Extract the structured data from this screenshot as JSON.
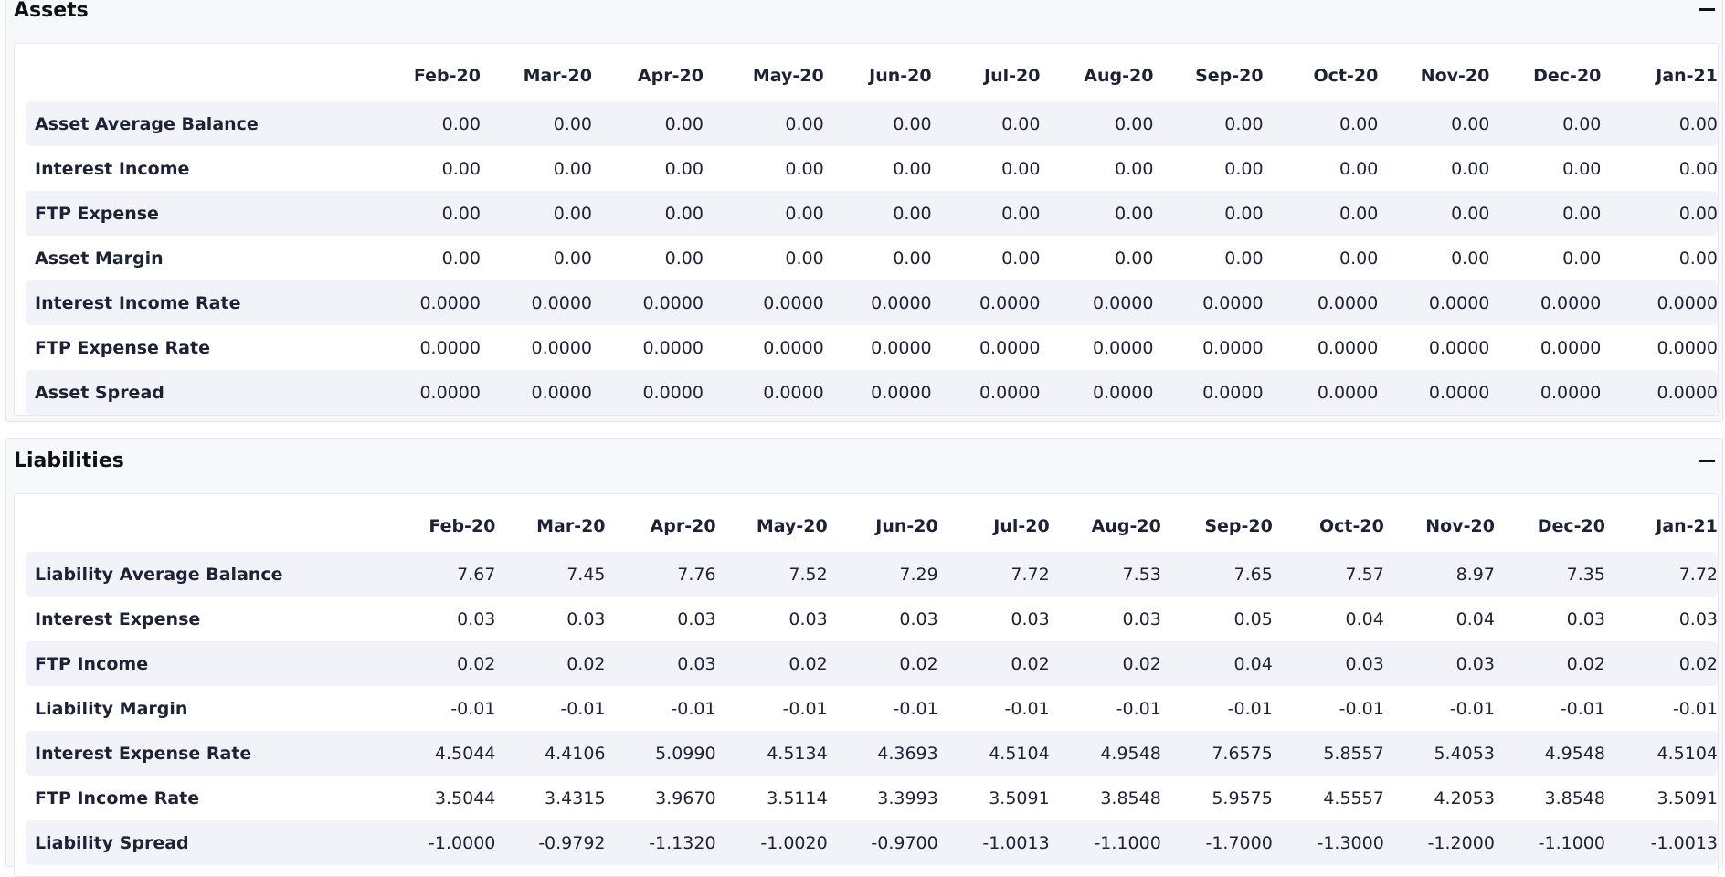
{
  "months": [
    "Feb-20",
    "Mar-20",
    "Apr-20",
    "May-20",
    "Jun-20",
    "Jul-20",
    "Aug-20",
    "Sep-20",
    "Oct-20",
    "Nov-20",
    "Dec-20",
    "Jan-21"
  ],
  "assets": {
    "title": "Assets",
    "rows": [
      {
        "label": "Asset Average Balance",
        "values": [
          "0.00",
          "0.00",
          "0.00",
          "0.00",
          "0.00",
          "0.00",
          "0.00",
          "0.00",
          "0.00",
          "0.00",
          "0.00",
          "0.00"
        ]
      },
      {
        "label": "Interest Income",
        "values": [
          "0.00",
          "0.00",
          "0.00",
          "0.00",
          "0.00",
          "0.00",
          "0.00",
          "0.00",
          "0.00",
          "0.00",
          "0.00",
          "0.00"
        ]
      },
      {
        "label": "FTP Expense",
        "values": [
          "0.00",
          "0.00",
          "0.00",
          "0.00",
          "0.00",
          "0.00",
          "0.00",
          "0.00",
          "0.00",
          "0.00",
          "0.00",
          "0.00"
        ]
      },
      {
        "label": "Asset Margin",
        "values": [
          "0.00",
          "0.00",
          "0.00",
          "0.00",
          "0.00",
          "0.00",
          "0.00",
          "0.00",
          "0.00",
          "0.00",
          "0.00",
          "0.00"
        ]
      },
      {
        "label": "Interest Income Rate",
        "values": [
          "0.0000",
          "0.0000",
          "0.0000",
          "0.0000",
          "0.0000",
          "0.0000",
          "0.0000",
          "0.0000",
          "0.0000",
          "0.0000",
          "0.0000",
          "0.0000"
        ]
      },
      {
        "label": "FTP Expense Rate",
        "values": [
          "0.0000",
          "0.0000",
          "0.0000",
          "0.0000",
          "0.0000",
          "0.0000",
          "0.0000",
          "0.0000",
          "0.0000",
          "0.0000",
          "0.0000",
          "0.0000"
        ]
      },
      {
        "label": "Asset Spread",
        "values": [
          "0.0000",
          "0.0000",
          "0.0000",
          "0.0000",
          "0.0000",
          "0.0000",
          "0.0000",
          "0.0000",
          "0.0000",
          "0.0000",
          "0.0000",
          "0.0000"
        ]
      }
    ]
  },
  "liabilities": {
    "title": "Liabilities",
    "rows": [
      {
        "label": "Liability Average Balance",
        "values": [
          "7.67",
          "7.45",
          "7.76",
          "7.52",
          "7.29",
          "7.72",
          "7.53",
          "7.65",
          "7.57",
          "8.97",
          "7.35",
          "7.72"
        ]
      },
      {
        "label": "Interest Expense",
        "values": [
          "0.03",
          "0.03",
          "0.03",
          "0.03",
          "0.03",
          "0.03",
          "0.03",
          "0.05",
          "0.04",
          "0.04",
          "0.03",
          "0.03"
        ]
      },
      {
        "label": "FTP Income",
        "values": [
          "0.02",
          "0.02",
          "0.03",
          "0.02",
          "0.02",
          "0.02",
          "0.02",
          "0.04",
          "0.03",
          "0.03",
          "0.02",
          "0.02"
        ]
      },
      {
        "label": "Liability Margin",
        "values": [
          "-0.01",
          "-0.01",
          "-0.01",
          "-0.01",
          "-0.01",
          "-0.01",
          "-0.01",
          "-0.01",
          "-0.01",
          "-0.01",
          "-0.01",
          "-0.01"
        ]
      },
      {
        "label": "Interest Expense Rate",
        "values": [
          "4.5044",
          "4.4106",
          "5.0990",
          "4.5134",
          "4.3693",
          "4.5104",
          "4.9548",
          "7.6575",
          "5.8557",
          "5.4053",
          "4.9548",
          "4.5104"
        ]
      },
      {
        "label": "FTP Income Rate",
        "values": [
          "3.5044",
          "3.4315",
          "3.9670",
          "3.5114",
          "3.3993",
          "3.5091",
          "3.8548",
          "5.9575",
          "4.5557",
          "4.2053",
          "3.8548",
          "3.5091"
        ]
      },
      {
        "label": "Liability Spread",
        "values": [
          "-1.0000",
          "-0.9792",
          "-1.1320",
          "-1.0020",
          "-0.9700",
          "-1.0013",
          "-1.1000",
          "-1.7000",
          "-1.3000",
          "-1.2000",
          "-1.1000",
          "-1.0013"
        ]
      }
    ]
  },
  "icons": {
    "collapse": "minus-icon"
  },
  "colors": {
    "stripe": "#f2f3f8",
    "text": "#1e2235",
    "panel": "#f7f8fb"
  }
}
